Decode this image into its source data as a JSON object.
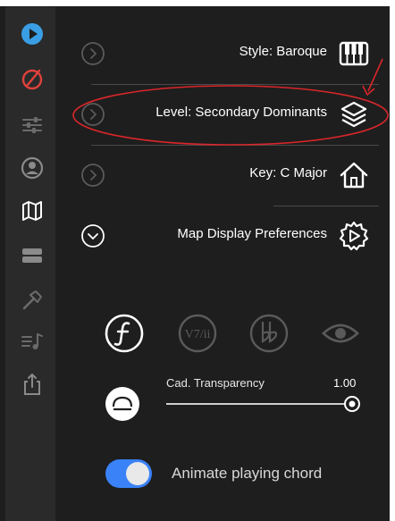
{
  "sidebar": {
    "items": [
      {
        "icon": "play-icon",
        "color": "#3a9ee4"
      },
      {
        "icon": "metronome-icon",
        "color": "#e0413c"
      },
      {
        "icon": "sliders-icon",
        "color": "#6b6b6b"
      },
      {
        "icon": "profile-icon",
        "color": "#8a8a8a"
      },
      {
        "icon": "map-icon",
        "color": "#ffffff"
      },
      {
        "icon": "layers-bar-icon",
        "color": "#8a8a8a"
      },
      {
        "icon": "hammer-icon",
        "color": "#6b6b6b"
      },
      {
        "icon": "music-list-icon",
        "color": "#6b6b6b"
      },
      {
        "icon": "share-icon",
        "color": "#8a8a8a"
      }
    ]
  },
  "rows": {
    "style": {
      "label": "Style: Baroque",
      "icon": "piano-keys-icon"
    },
    "level": {
      "label": "Level: Secondary Dominants",
      "icon": "stack-icon"
    },
    "key": {
      "label": "Key: C Major",
      "icon": "home-icon"
    },
    "map_prefs": {
      "label": "Map Display Preferences",
      "icon": "gear-play-icon"
    }
  },
  "notation_buttons": [
    {
      "icon": "function-f-icon",
      "active": true
    },
    {
      "icon": "secondary-v7-icon",
      "active": false
    },
    {
      "icon": "double-flat-icon",
      "active": false
    },
    {
      "icon": "eye-icon",
      "active": false
    }
  ],
  "cad_transparency": {
    "label": "Cad. Transparency",
    "value_text": "1.00",
    "value": 1.0
  },
  "animate_toggle": {
    "label": "Animate playing chord",
    "on": true
  },
  "colors": {
    "background": "#1e1e1e",
    "sidebar": "#2a2a2a",
    "accent_blue": "#3a82f7",
    "annotation_red": "#d9262a"
  }
}
